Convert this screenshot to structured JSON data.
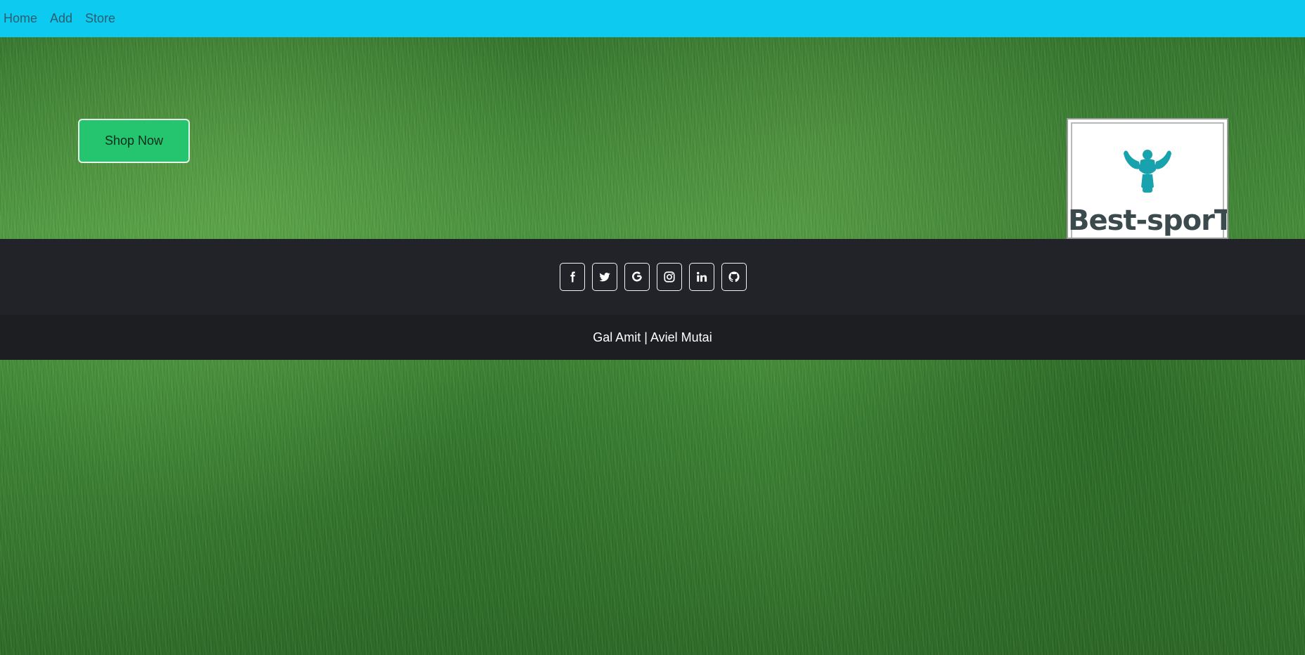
{
  "nav": {
    "items": [
      {
        "label": "Home"
      },
      {
        "label": "Add"
      },
      {
        "label": "Store"
      }
    ]
  },
  "hero": {
    "shop_button_label": "Shop Now",
    "logo_text": "Best-sporT"
  },
  "footer": {
    "social": [
      {
        "icon": "facebook-icon"
      },
      {
        "icon": "twitter-icon"
      },
      {
        "icon": "google-icon"
      },
      {
        "icon": "instagram-icon"
      },
      {
        "icon": "linkedin-icon"
      },
      {
        "icon": "github-icon"
      }
    ],
    "credits": "Gal Amit | Aviel Mutai"
  },
  "colors": {
    "navbar": "#0dcaf0",
    "shop_button": "#25c56f",
    "footer_dark": "#212329",
    "credits_dark": "#1c1e22",
    "logo_teal": "#17a2ad"
  }
}
